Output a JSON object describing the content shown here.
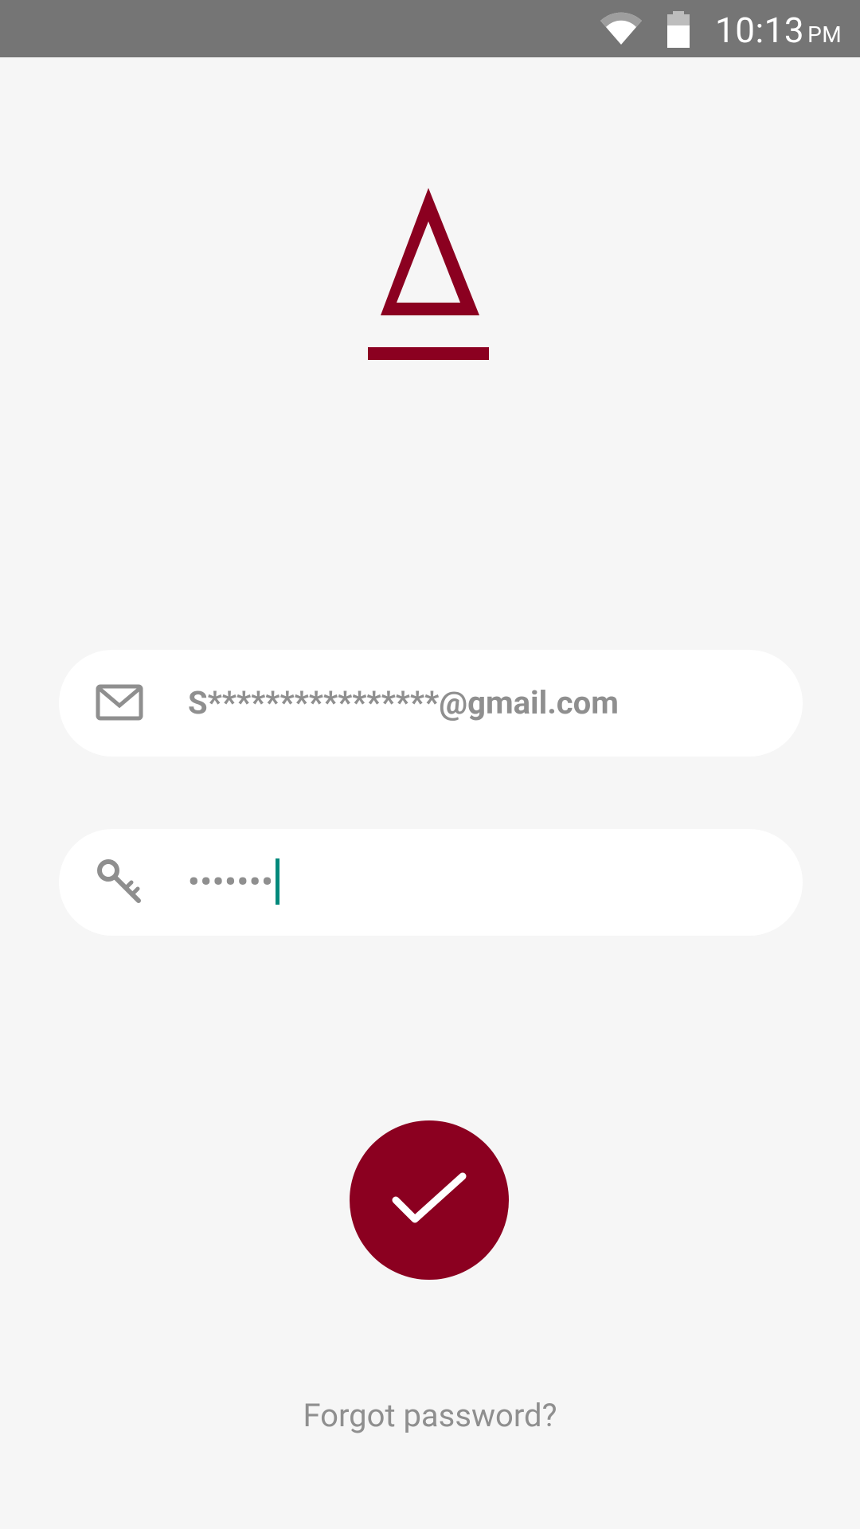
{
  "status_bar": {
    "time": "10:13",
    "ampm": "PM",
    "icons": [
      "wifi-icon",
      "battery-icon"
    ],
    "background": "#757575"
  },
  "logo": {
    "name": "brand-logo",
    "color": "#8b0020"
  },
  "login": {
    "email_value": "S****************@gmail.com",
    "email_icon": "mail-icon",
    "password_value": "•••••••",
    "password_icon": "key-icon",
    "submit_icon": "checkmark-icon",
    "submit_color": "#8b0020",
    "cursor_color": "#00897b"
  },
  "forgot_password": "Forgot password?"
}
